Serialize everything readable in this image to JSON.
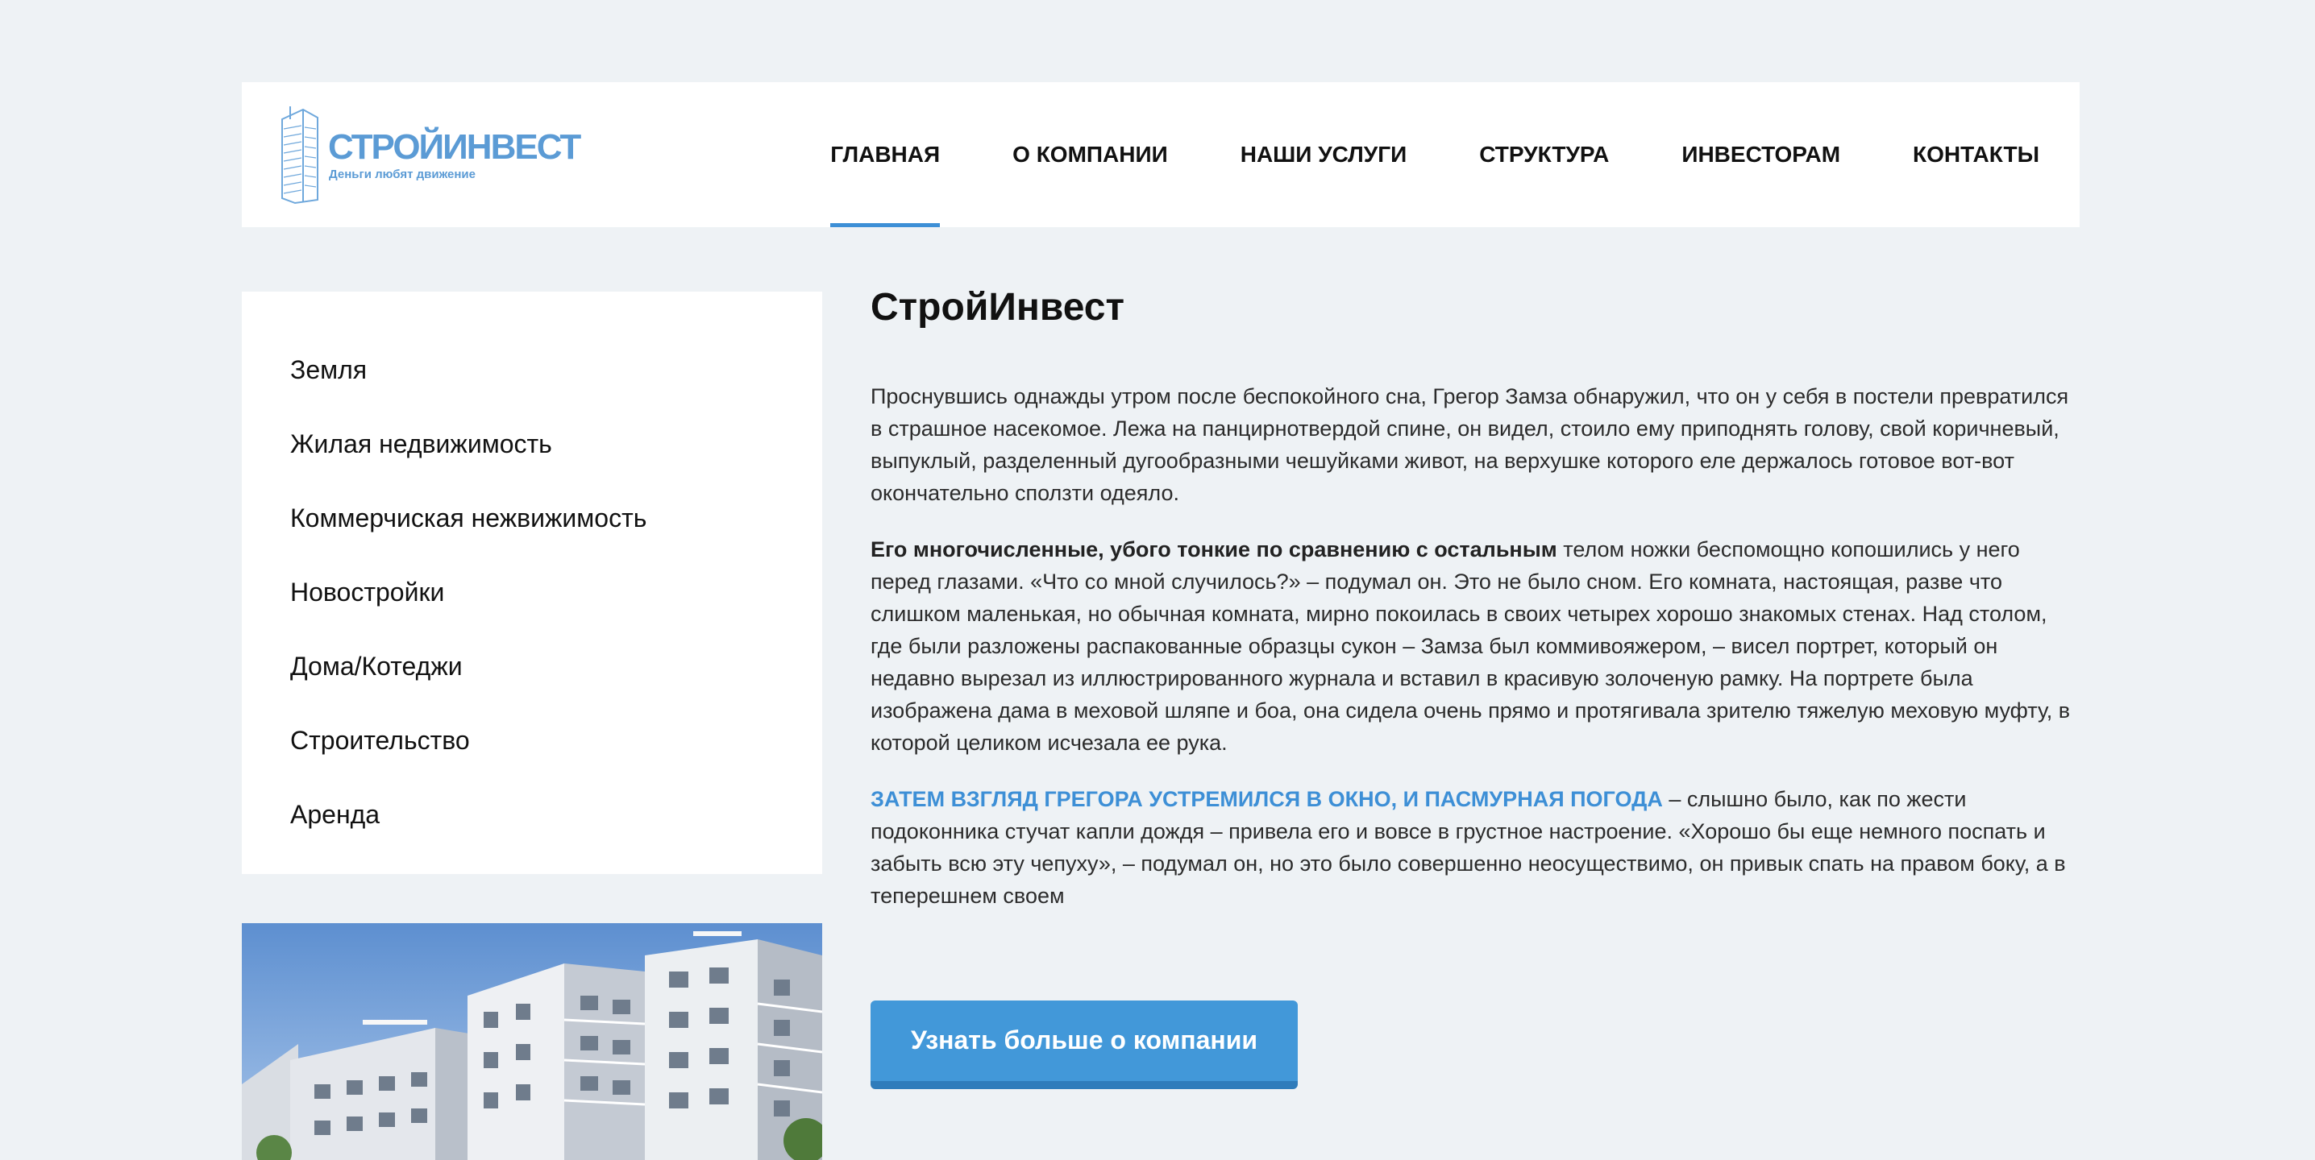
{
  "logo": {
    "name": "СТРОЙИНВЕСТ",
    "tagline": "Деньги любят движение"
  },
  "nav": {
    "items": [
      "ГЛАВНАЯ",
      "О КОМПАНИИ",
      "НАШИ УСЛУГИ",
      "СТРУКТУРА",
      "ИНВЕСТОРАМ",
      "КОНТАКТЫ"
    ],
    "active_index": 0
  },
  "sidebar": {
    "items": [
      "Земля",
      "Жилая недвижимость",
      "Коммерчиская нежвижимость",
      "Новостройки",
      "Дома/Котеджи",
      "Строительство",
      "Аренда"
    ]
  },
  "main": {
    "title": "СтройИнвест",
    "p1": "Проснувшись однажды утром после беспокойного сна, Грегор Замза обнаружил, что он у себя в постели превратился в страшное насекомое. Лежа на панцирнотвердой спине, он видел, стоило ему приподнять голову, свой коричневый, выпуклый, разделенный дугообразными чешуйками живот, на верхушке которого еле держалось готовое вот-вот окончательно сползти одеяло.",
    "p2_strong": "Его многочисленные, убого тонкие по сравнению с остальным",
    "p2_rest": " телом ножки беспомощно копошились у него перед глазами. «Что со мной случилось?» – подумал он. Это не было сном. Его комната, настоящая, разве что слишком маленькая, но обычная комната, мирно покоилась в своих четырех хорошо знакомых стенах. Над столом, где были разложены распакованные образцы сукон – Замза был коммивояжером, – висел портрет, который он недавно вырезал из иллюстрированного журнала и вставил в красивую золоченую рамку. На портрете была изображена дама в меховой шляпе и боа, она сидела очень прямо и протягивала зрителю тяжелую меховую муфту, в которой целиком исчезала ее рука.",
    "p3_highlight": "ЗАТЕМ ВЗГЛЯД ГРЕГОРА УСТРЕМИЛСЯ В ОКНО, И ПАСМУРНАЯ ПОГОДА",
    "p3_rest": " – слышно было, как по жести подоконника стучат капли дождя – привела его и вовсе в грустное настроение. «Хорошо бы еще немного поспать и забыть всю эту чепуху», – подумал он, но это было совершенно неосуществимо, он привык спать на правом боку, а в теперешнем своем"
  },
  "cta": {
    "label": "Узнать больше о компании"
  },
  "colors": {
    "accent": "#3d8fd6",
    "background": "#eef2f5",
    "logo": "#5b9bd5"
  }
}
